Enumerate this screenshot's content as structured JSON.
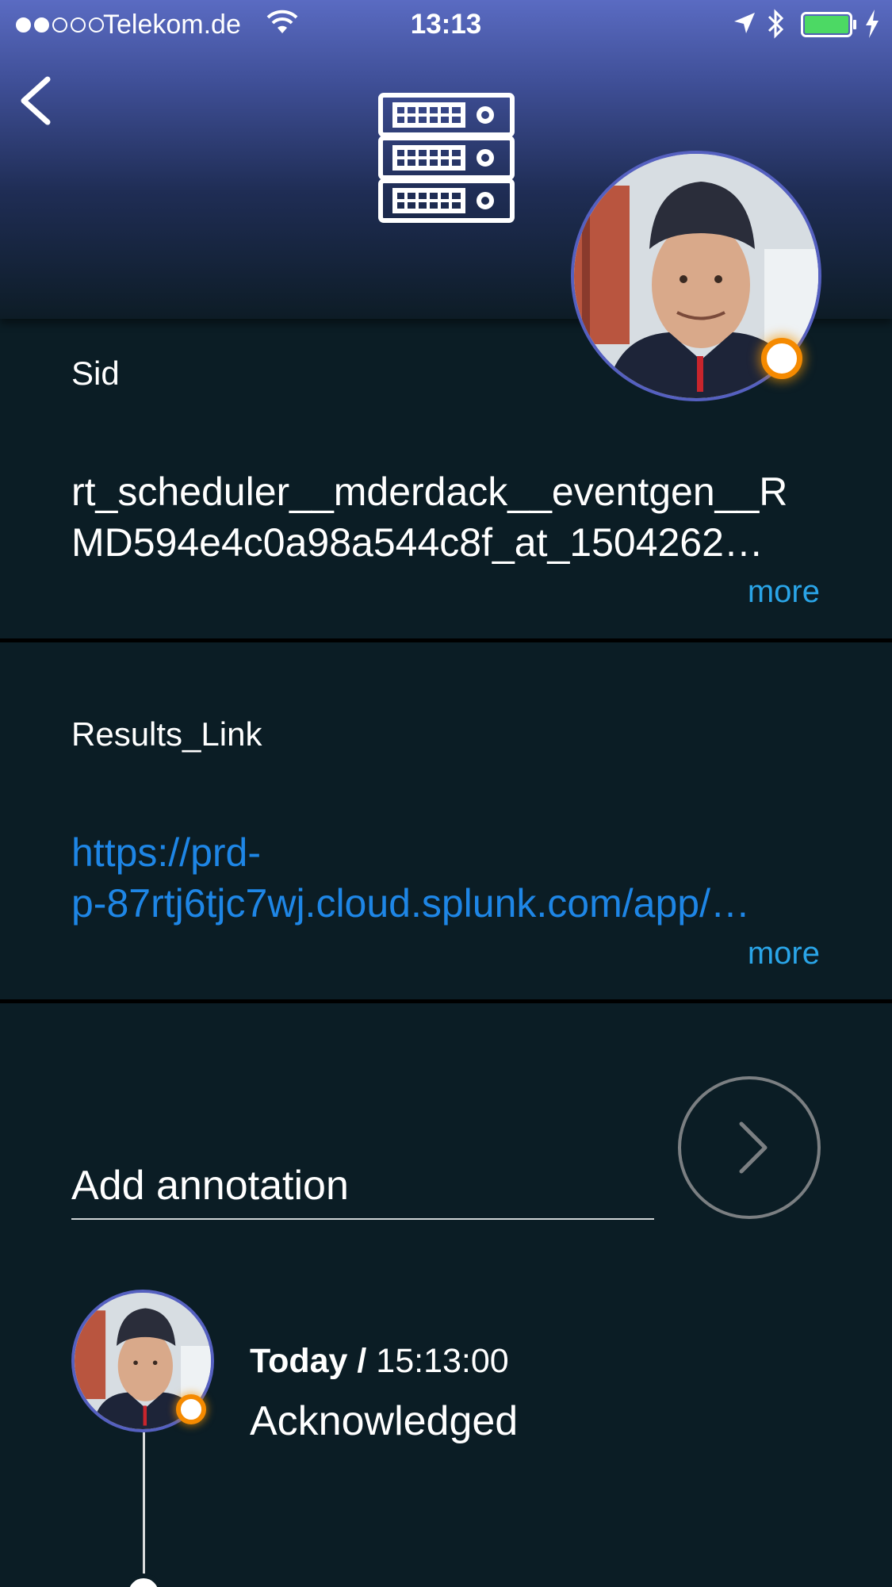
{
  "status_bar": {
    "carrier": "Telekom.de",
    "time": "13:13",
    "signal_dots_filled": 2,
    "signal_dots_total": 5,
    "battery_level": 0.9
  },
  "header": {
    "back_icon": "chevron-left-icon",
    "type_icon": "server-rack-icon",
    "avatar_status_color": "#f58a00"
  },
  "fields": [
    {
      "label": "Sid",
      "value_line1": "rt_scheduler__mderdack__eventgen__R",
      "value_line2": "MD594e4c0a98a544c8f_at_1504262…",
      "more_label": "more"
    },
    {
      "label": "Results_Link",
      "value_line1": "https://prd-",
      "value_line2": "p-87rtj6tjc7wj.cloud.splunk.com/app/…",
      "more_label": "more"
    }
  ],
  "annotation": {
    "placeholder": "Add annotation",
    "send_icon": "chevron-right-icon"
  },
  "timeline": [
    {
      "day": "Today /",
      "time": " 15:13:00",
      "status": "Acknowledged"
    }
  ],
  "colors": {
    "background": "#0b1d25",
    "accent_link": "#1e86e6",
    "more_link": "#2aa5e8",
    "avatar_ring": "#5560c0",
    "status_orange": "#f58a00"
  }
}
